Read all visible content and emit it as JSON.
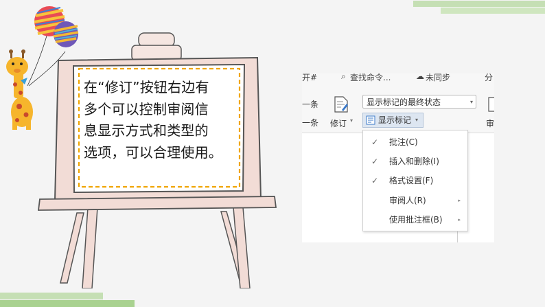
{
  "board": {
    "text": "在“修订”按钮右边有\n多个可以控制审阅信\n息显示方式和类型的\n选项，可以合理使用。"
  },
  "ui": {
    "top_strip": [
      "开#",
      "查找命令...",
      "未同步",
      "分"
    ],
    "ribbon": {
      "prev_label": "一条",
      "next_label": "一条",
      "revise_label": "修订",
      "revise_arrow": "▾",
      "markup_state": "显示标记的最终状态",
      "show_markup": "显示标记",
      "show_markup_arrow": "▾",
      "right_label": "审"
    },
    "menu": {
      "items": [
        {
          "label": "批注(C)",
          "checked": "✓",
          "submenu": ""
        },
        {
          "label": "插入和删除(I)",
          "checked": "✓",
          "submenu": ""
        },
        {
          "label": "格式设置(F)",
          "checked": "✓",
          "submenu": ""
        },
        {
          "label": "审阅人(R)",
          "checked": "",
          "submenu": "▸"
        },
        {
          "label": "使用批注框(B)",
          "checked": "",
          "submenu": "▸"
        }
      ]
    }
  },
  "colors": {
    "accent_green": "#c5dfb4",
    "accent_green_dark": "#8cc66e",
    "frame_pink": "#f2dcd6",
    "board_border": "#555555",
    "dash_orange": "#f0a500",
    "button_highlight": "#dde6f1"
  }
}
